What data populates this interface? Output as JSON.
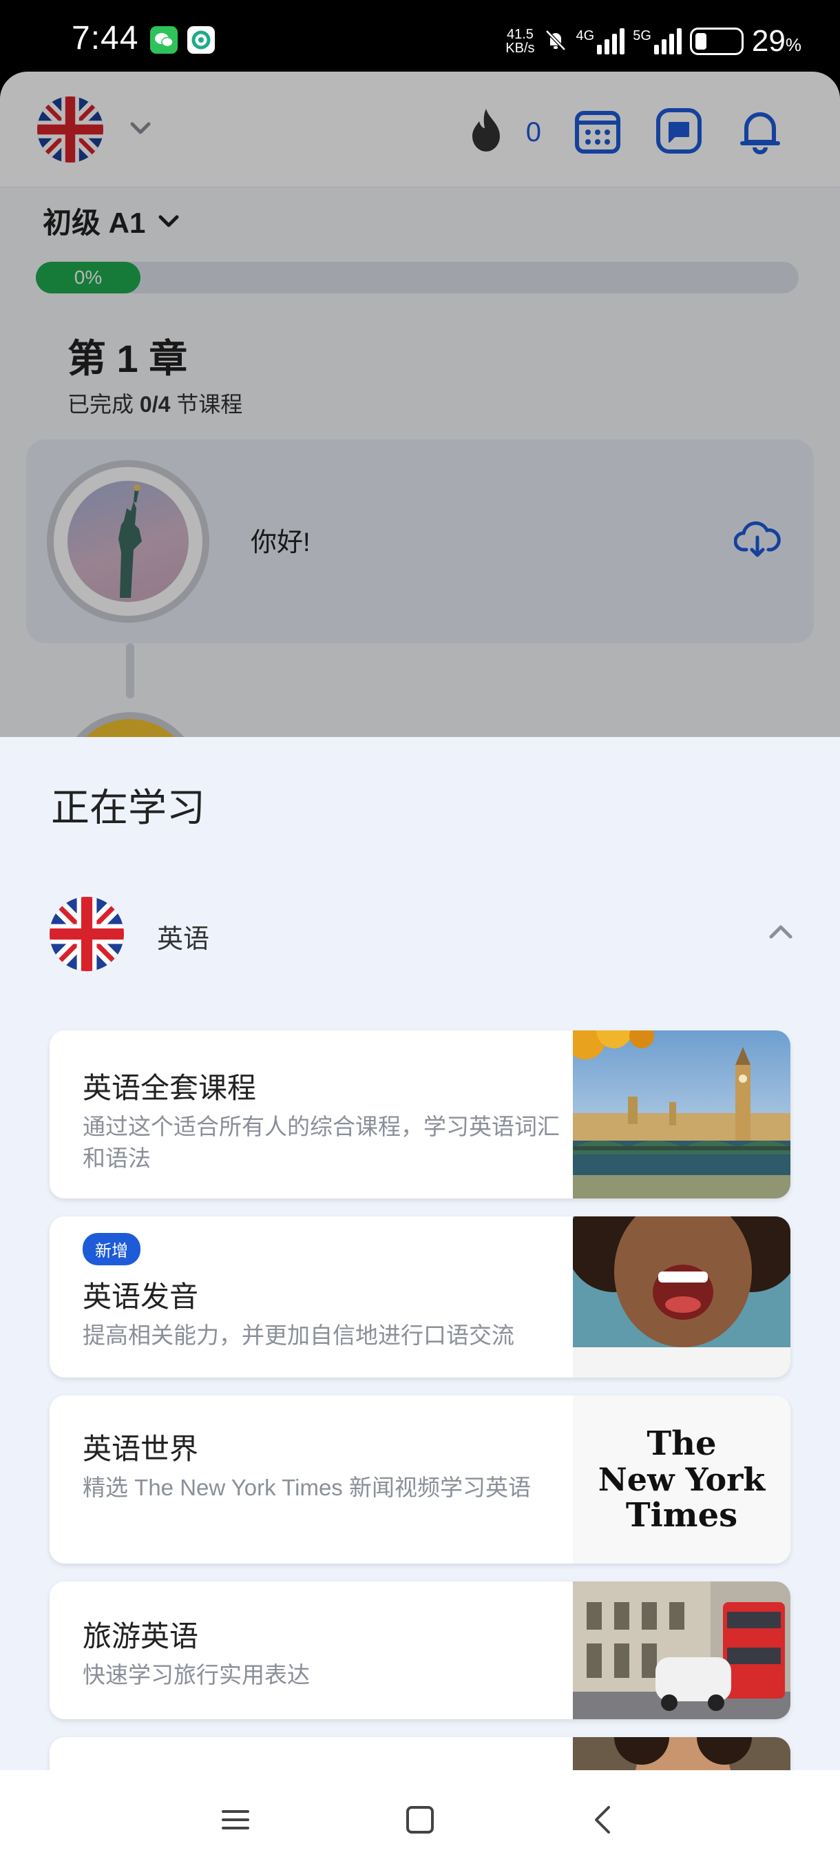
{
  "status_bar": {
    "time": "7:44",
    "net_speed_value": "41.5",
    "net_speed_unit": "KB/s",
    "sig1": "4G",
    "sig2": "5G",
    "battery_pct": "29",
    "battery_unit": "%"
  },
  "app_header": {
    "streak_count": "0"
  },
  "course_progress": {
    "level": "初级 A1",
    "percent": 0,
    "percent_label": "0%",
    "chapter": "第 1 章",
    "completed_prefix": "已完成 ",
    "completed_count": "0/4",
    "completed_suffix": " 节课程",
    "lesson_title": "你好!"
  },
  "sheet": {
    "title": "正在学习",
    "language": "英语",
    "courses": [
      {
        "title": "英语全套课程",
        "desc": "通过这个适合所有人的综合课程，学习英语词汇和语法",
        "badge": ""
      },
      {
        "title": "英语发音",
        "desc": "提高相关能力，并更加自信地进行口语交流",
        "badge": "新增"
      },
      {
        "title": "英语世界",
        "desc": "精选 The New York Times 新闻视频学习英语",
        "badge": ""
      },
      {
        "title": "旅游英语",
        "desc": "快速学习旅行实用表达",
        "badge": ""
      }
    ],
    "nyt_logo_lines": [
      "The",
      "New York",
      "Times"
    ]
  },
  "colors": {
    "accent_blue": "#1e5bd8",
    "progress_green": "#1faa4f"
  }
}
